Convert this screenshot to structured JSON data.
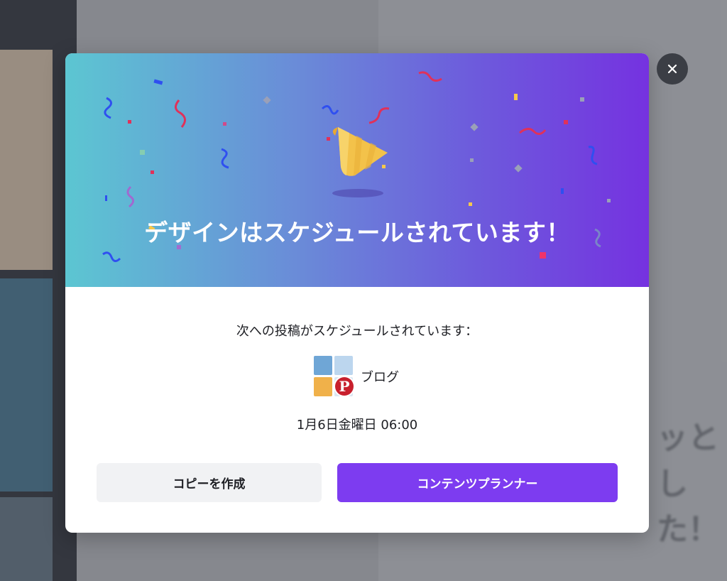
{
  "background": {
    "text_1": "ッと",
    "text_2": "した！"
  },
  "modal": {
    "title": "デザインはスケジュールされています！",
    "subtitle": "次への投稿がスケジュールされています：",
    "account_name": "ブログ",
    "schedule_datetime": "1月6日金曜日 06:00",
    "copy_button_label": "コピーを作成",
    "planner_button_label": "コンテンツプランナー",
    "close_icon": "close-icon",
    "hero_icon": "party-popper-icon",
    "platform_icon": "pinterest-icon"
  },
  "colors": {
    "primary": "#7d3cf0",
    "gradient_start": "#5cc6d2",
    "gradient_end": "#7532e0",
    "pinterest": "#c8202d"
  }
}
